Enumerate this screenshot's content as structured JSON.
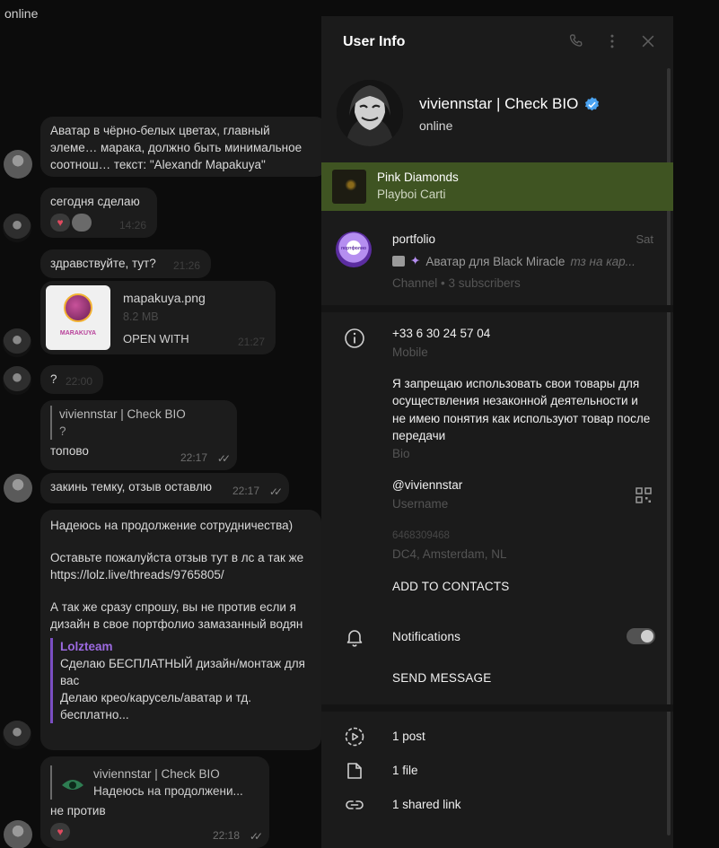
{
  "chat": {
    "status": "online",
    "messages": [
      {
        "text": "Аватар в чёрно-белых цветах, главный элеме… марака, должно быть минимальное соотнош… текст: \"Alexandr Mapakuya\""
      },
      {
        "text": "сегодня сделаю",
        "time": "14:26"
      },
      {
        "text": "здравствуйте, тут?",
        "time": "21:26"
      },
      {
        "file_name": "mapakuya.png",
        "file_size": "8.2 MB",
        "open": "OPEN WITH",
        "time": "21:27",
        "thumb_brand": "MARAKUYA"
      },
      {
        "text": "?",
        "time": "22:00"
      },
      {
        "reply_name": "viviennstar | Check BIO",
        "reply_text": "?",
        "text": "топово",
        "time": "22:17"
      },
      {
        "text": "закинь темку, отзыв оставлю",
        "time": "22:17"
      },
      {
        "text1": "Надеюсь на продолжение сотрудничества)",
        "text2": "Оставьте пожалуйста отзыв тут в лс а так же",
        "link": "https://lolz.live/threads/9765805/",
        "text3": "А так же сразу спрошу, вы не против если я",
        "text4": "дизайн в свое портфолио замазанный водян",
        "quote_name": "Lolzteam",
        "quote_line1": "Сделаю БЕСПЛАТНЫЙ дизайн/монтаж для",
        "quote_line2": "вас",
        "quote_line3": "Делаю крео/карусель/аватар и тд.",
        "quote_line4": "бесплатно..."
      },
      {
        "reply_name": "viviennstar | Check BIO",
        "reply_text": "Надеюсь на продолжени...",
        "text": "не против",
        "time": "22:18"
      }
    ]
  },
  "panel": {
    "title": "User Info",
    "icons": [
      "phone-icon",
      "more-vertical-icon",
      "close-icon"
    ],
    "profile": {
      "name": "viviennstar | Check BIO",
      "status": "online",
      "verified": true
    },
    "music": {
      "title": "Pink Diamonds",
      "artist": "Playboi Carti"
    },
    "channel": {
      "name": "portfolio",
      "day": "Sat",
      "last_message": "Аватар для Black Miracle",
      "last_note": "тз на кар...",
      "meta": "Channel • 3 subscribers",
      "avatar_text": "портфолио"
    },
    "phone": {
      "value": "+33 6 30 24 57 04",
      "label": "Mobile"
    },
    "bio": {
      "value": "Я запрещаю использовать свои товары для осуществления незаконной деятельности и не имею понятия как используют товар после передачи",
      "label": "Bio"
    },
    "username": {
      "value": "@viviennstar",
      "label": "Username"
    },
    "user_id": "6468309468",
    "dc": "DC4, Amsterdam, NL",
    "add_contacts": "ADD TO CONTACTS",
    "notifications": {
      "label": "Notifications",
      "enabled": true
    },
    "send_message": "SEND MESSAGE",
    "media": {
      "posts": "1 post",
      "files": "1 file",
      "links": "1 shared link"
    },
    "colors": {
      "panel_bg": "#1b1b1b",
      "music_bg": "#3f5422",
      "verified": "#4ba3f0",
      "quote_accent": "#7a4ec2"
    }
  }
}
